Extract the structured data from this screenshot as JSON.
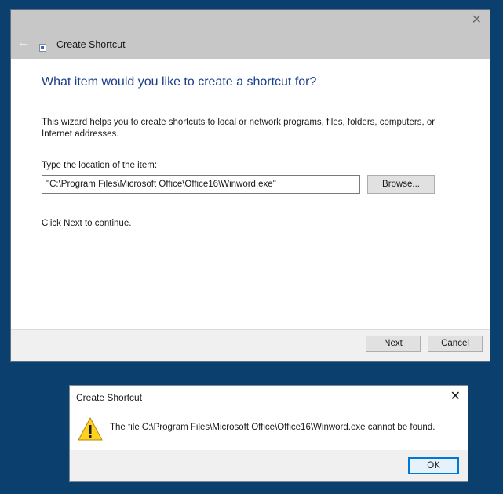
{
  "wizard": {
    "title": "Create Shortcut",
    "heading": "What item would you like to create a shortcut for?",
    "description": "This wizard helps you to create shortcuts to local or network programs, files, folders, computers, or Internet addresses.",
    "location_label": "Type the location of the item:",
    "location_value": "\"C:\\Program Files\\Microsoft Office\\Office16\\Winword.exe\"",
    "browse_label": "Browse...",
    "continue_text": "Click Next to continue.",
    "next_label": "Next",
    "cancel_label": "Cancel",
    "back_glyph": "←",
    "close_glyph": "✕"
  },
  "error_dialog": {
    "title": "Create Shortcut",
    "message": "The file C:\\Program Files\\Microsoft Office\\Office16\\Winword.exe cannot be found.",
    "ok_label": "OK",
    "close_glyph": "✕",
    "icon": "warning-icon"
  },
  "colors": {
    "desktop": "#0a3f6e",
    "heading": "#1a3e8c",
    "focus_border": "#0078d7",
    "warning_fill": "#ffd21f"
  }
}
